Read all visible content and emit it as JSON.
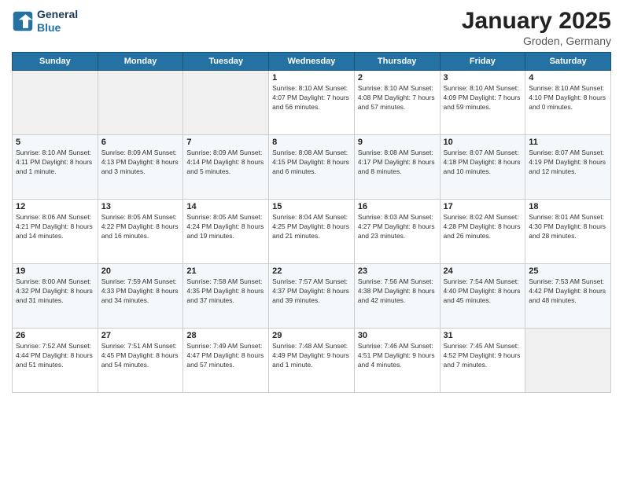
{
  "header": {
    "logo_line1": "General",
    "logo_line2": "Blue",
    "month_title": "January 2025",
    "location": "Groden, Germany"
  },
  "days_of_week": [
    "Sunday",
    "Monday",
    "Tuesday",
    "Wednesday",
    "Thursday",
    "Friday",
    "Saturday"
  ],
  "weeks": [
    [
      {
        "day": "",
        "info": ""
      },
      {
        "day": "",
        "info": ""
      },
      {
        "day": "",
        "info": ""
      },
      {
        "day": "1",
        "info": "Sunrise: 8:10 AM\nSunset: 4:07 PM\nDaylight: 7 hours\nand 56 minutes."
      },
      {
        "day": "2",
        "info": "Sunrise: 8:10 AM\nSunset: 4:08 PM\nDaylight: 7 hours\nand 57 minutes."
      },
      {
        "day": "3",
        "info": "Sunrise: 8:10 AM\nSunset: 4:09 PM\nDaylight: 7 hours\nand 59 minutes."
      },
      {
        "day": "4",
        "info": "Sunrise: 8:10 AM\nSunset: 4:10 PM\nDaylight: 8 hours\nand 0 minutes."
      }
    ],
    [
      {
        "day": "5",
        "info": "Sunrise: 8:10 AM\nSunset: 4:11 PM\nDaylight: 8 hours\nand 1 minute."
      },
      {
        "day": "6",
        "info": "Sunrise: 8:09 AM\nSunset: 4:13 PM\nDaylight: 8 hours\nand 3 minutes."
      },
      {
        "day": "7",
        "info": "Sunrise: 8:09 AM\nSunset: 4:14 PM\nDaylight: 8 hours\nand 5 minutes."
      },
      {
        "day": "8",
        "info": "Sunrise: 8:08 AM\nSunset: 4:15 PM\nDaylight: 8 hours\nand 6 minutes."
      },
      {
        "day": "9",
        "info": "Sunrise: 8:08 AM\nSunset: 4:17 PM\nDaylight: 8 hours\nand 8 minutes."
      },
      {
        "day": "10",
        "info": "Sunrise: 8:07 AM\nSunset: 4:18 PM\nDaylight: 8 hours\nand 10 minutes."
      },
      {
        "day": "11",
        "info": "Sunrise: 8:07 AM\nSunset: 4:19 PM\nDaylight: 8 hours\nand 12 minutes."
      }
    ],
    [
      {
        "day": "12",
        "info": "Sunrise: 8:06 AM\nSunset: 4:21 PM\nDaylight: 8 hours\nand 14 minutes."
      },
      {
        "day": "13",
        "info": "Sunrise: 8:05 AM\nSunset: 4:22 PM\nDaylight: 8 hours\nand 16 minutes."
      },
      {
        "day": "14",
        "info": "Sunrise: 8:05 AM\nSunset: 4:24 PM\nDaylight: 8 hours\nand 19 minutes."
      },
      {
        "day": "15",
        "info": "Sunrise: 8:04 AM\nSunset: 4:25 PM\nDaylight: 8 hours\nand 21 minutes."
      },
      {
        "day": "16",
        "info": "Sunrise: 8:03 AM\nSunset: 4:27 PM\nDaylight: 8 hours\nand 23 minutes."
      },
      {
        "day": "17",
        "info": "Sunrise: 8:02 AM\nSunset: 4:28 PM\nDaylight: 8 hours\nand 26 minutes."
      },
      {
        "day": "18",
        "info": "Sunrise: 8:01 AM\nSunset: 4:30 PM\nDaylight: 8 hours\nand 28 minutes."
      }
    ],
    [
      {
        "day": "19",
        "info": "Sunrise: 8:00 AM\nSunset: 4:32 PM\nDaylight: 8 hours\nand 31 minutes."
      },
      {
        "day": "20",
        "info": "Sunrise: 7:59 AM\nSunset: 4:33 PM\nDaylight: 8 hours\nand 34 minutes."
      },
      {
        "day": "21",
        "info": "Sunrise: 7:58 AM\nSunset: 4:35 PM\nDaylight: 8 hours\nand 37 minutes."
      },
      {
        "day": "22",
        "info": "Sunrise: 7:57 AM\nSunset: 4:37 PM\nDaylight: 8 hours\nand 39 minutes."
      },
      {
        "day": "23",
        "info": "Sunrise: 7:56 AM\nSunset: 4:38 PM\nDaylight: 8 hours\nand 42 minutes."
      },
      {
        "day": "24",
        "info": "Sunrise: 7:54 AM\nSunset: 4:40 PM\nDaylight: 8 hours\nand 45 minutes."
      },
      {
        "day": "25",
        "info": "Sunrise: 7:53 AM\nSunset: 4:42 PM\nDaylight: 8 hours\nand 48 minutes."
      }
    ],
    [
      {
        "day": "26",
        "info": "Sunrise: 7:52 AM\nSunset: 4:44 PM\nDaylight: 8 hours\nand 51 minutes."
      },
      {
        "day": "27",
        "info": "Sunrise: 7:51 AM\nSunset: 4:45 PM\nDaylight: 8 hours\nand 54 minutes."
      },
      {
        "day": "28",
        "info": "Sunrise: 7:49 AM\nSunset: 4:47 PM\nDaylight: 8 hours\nand 57 minutes."
      },
      {
        "day": "29",
        "info": "Sunrise: 7:48 AM\nSunset: 4:49 PM\nDaylight: 9 hours\nand 1 minute."
      },
      {
        "day": "30",
        "info": "Sunrise: 7:46 AM\nSunset: 4:51 PM\nDaylight: 9 hours\nand 4 minutes."
      },
      {
        "day": "31",
        "info": "Sunrise: 7:45 AM\nSunset: 4:52 PM\nDaylight: 9 hours\nand 7 minutes."
      },
      {
        "day": "",
        "info": ""
      }
    ]
  ]
}
